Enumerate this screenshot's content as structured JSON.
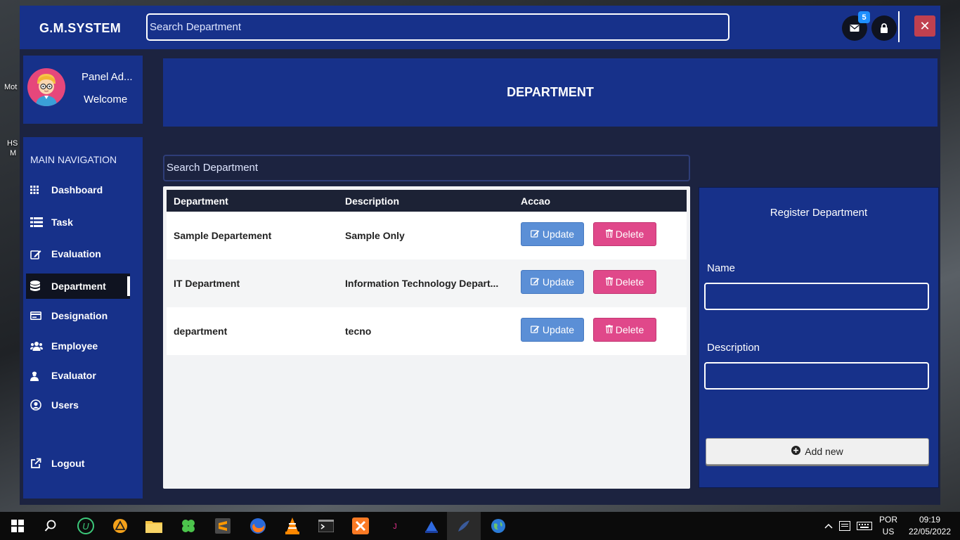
{
  "desktop": {
    "label_fragments": [
      "Mot",
      "HS",
      "M"
    ]
  },
  "app": {
    "brand": "G.M.SYSTEM",
    "top_search_placeholder": "Search Department",
    "mail_badge": "5",
    "close_glyph": "✕"
  },
  "profile": {
    "name": "Panel Ad...",
    "greeting": "Welcome"
  },
  "sidebar": {
    "header": "MAIN NAVIGATION",
    "items": [
      {
        "label": "Dashboard",
        "icon": "grid-icon"
      },
      {
        "label": "Task",
        "icon": "list-icon"
      },
      {
        "label": "Evaluation",
        "icon": "edit-icon"
      },
      {
        "label": "Department",
        "icon": "database-icon",
        "active": true
      },
      {
        "label": "Designation",
        "icon": "card-icon"
      },
      {
        "label": "Employee",
        "icon": "users-icon"
      },
      {
        "label": "Evaluator",
        "icon": "person-icon"
      },
      {
        "label": "Users",
        "icon": "user-circle-icon"
      }
    ],
    "logout": "Logout"
  },
  "page": {
    "title": "DEPARTMENT",
    "list_search_placeholder": "Search Department"
  },
  "table": {
    "headers": [
      "Department",
      "Description",
      "Accao"
    ],
    "rows": [
      {
        "department": "Sample  Departement",
        "description": "Sample Only"
      },
      {
        "department": "IT Department",
        "description": "Information Technology Depart..."
      },
      {
        "department": "department",
        "description": "tecno"
      }
    ],
    "update_label": "Update",
    "delete_label": "Delete"
  },
  "form": {
    "title": "Register  Department",
    "name_label": "Name",
    "name_value": "",
    "description_label": "Description",
    "description_value": "",
    "submit_label": "Add new"
  },
  "taskbar": {
    "language": "POR",
    "layout": "US",
    "time": "09:19",
    "date": "22/05/2022"
  },
  "colors": {
    "primary": "#17318a",
    "dark": "#1c2340",
    "update": "#5b8fd6",
    "delete": "#e0488a",
    "close": "#c0404f"
  }
}
